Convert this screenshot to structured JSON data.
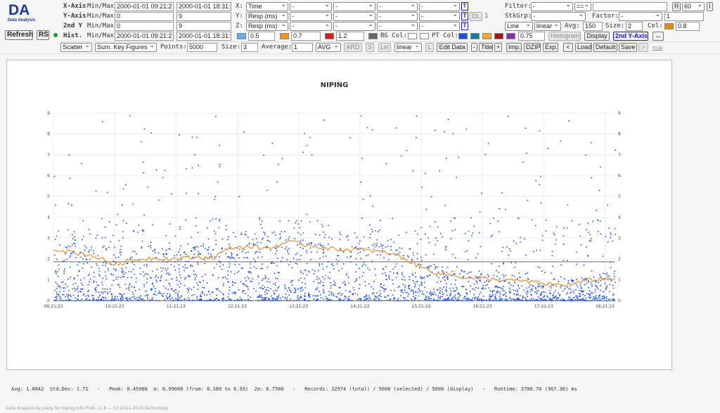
{
  "app": {
    "logo": "DA",
    "logo_sub": "Data Analysis",
    "refresh": "Refresh",
    "rs": "RS",
    "status_color": "#1aa01a"
  },
  "rows": {
    "xaxis": {
      "label": "X-Axis",
      "minmax": "Min/Max",
      "min": "2000-01-01 09:21:2",
      "max": "2000-01-01 18:31:4"
    },
    "yaxis": {
      "label": "Y-Axis",
      "minmax": "Min/Max",
      "min": "0",
      "max": "9"
    },
    "y2": {
      "label": "2nd Y",
      "minmax": "Min/Max",
      "min": "0",
      "max": "9"
    },
    "hist": {
      "label": "Hist.",
      "minmax": "Min/Max",
      "min": "2000-01-01 09:21:2",
      "max": "2000-01-01 18:31:4"
    }
  },
  "fields": {
    "x": {
      "label": "X:",
      "value": "Time"
    },
    "y": {
      "label": "Y:",
      "value": "Resp (ms)"
    },
    "z": {
      "label": "Z:",
      "value": "Resp (ms)"
    },
    "dash": "-",
    "t": "T",
    "dl": "DL",
    "dl_val": "1"
  },
  "right": {
    "filter_label": "Filter:",
    "filter_val": "-",
    "filter_op": "==",
    "r": "R",
    "r_val": "60",
    "i": "I",
    "stkgrp_label": "StkGrp:",
    "stkgrp_val": "-",
    "factor_label": "Factor:",
    "factor_val": "-",
    "factor_num": "1",
    "line": "Line",
    "linear": "linear",
    "avg_label": "Avg:",
    "avg_val": "150",
    "size_label": "Size:",
    "size_val": "2",
    "col_label": "Col:",
    "col_color": "#e08c1a",
    "col_val": "0.8"
  },
  "hist_row": {
    "c1": "#6fa8e8",
    "v1": "0.5",
    "c2": "#f0961e",
    "v2": "0.7",
    "c3": "#e01a1a",
    "v3": "1.2",
    "c4": "#666666",
    "bg_label": "BG Col:",
    "pt_label": "PT Col:",
    "pt1": "#1a4ee8",
    "pt2": "#1a7a9a",
    "pt3": "#f0a830",
    "pt4": "#a01a1a",
    "pt5": "#8a2ab0",
    "pt_val": "0.75",
    "histogram": "Histogram",
    "display": "Display",
    "y2axis": "2nd Y-Axis",
    "arrows": "↔"
  },
  "toolbar": {
    "type": "Scatter",
    "agg": "Sum. Key Figures",
    "points_label": "Points:",
    "points": "5000",
    "size_label": "Size:",
    "size": "3",
    "average_label": "Average:",
    "average": "1",
    "avgsel": "AVG",
    "ard": "ARD",
    "s": "S",
    "lin": "Lin",
    "linear": "linear",
    "l": "L",
    "edit": "Edit Data",
    "minus": "-",
    "title": "Title",
    "plus": "+",
    "imp": "Imp.",
    "dzip": "DZIP",
    "exp": "Exp.",
    "lt": "<",
    "load": "Load",
    "default": "Default",
    "save": "Save",
    "gt": ">",
    "hide": "Hide"
  },
  "chart_data": {
    "type": "scatter",
    "title": "NIPING",
    "xlabel": "",
    "ylabel": "",
    "x_ticks": [
      "09:21:23",
      "10:21:23",
      "11:21:23",
      "12:21:23",
      "13:21:23",
      "14:21:23",
      "15:21:23",
      "16:21:23",
      "17:21:23",
      "18:21:23"
    ],
    "ylim": [
      0,
      9
    ],
    "y_ticks": [
      "0",
      "1",
      "2",
      "3",
      "4",
      "5",
      "6",
      "7",
      "8",
      "9"
    ],
    "y2_ticks": [
      "0",
      "1",
      "2",
      "3",
      "4",
      "5",
      "6",
      "7",
      "8",
      "9"
    ],
    "reference_line": 1.86,
    "grid": true,
    "series": [
      {
        "type": "scatter",
        "color": "#1a4ee8",
        "points_note": "5000 points"
      },
      {
        "type": "line",
        "color": "#e8902a",
        "x_hours": [
          0,
          0.1,
          0.3,
          0.6,
          1.0,
          1.3,
          1.6,
          2.0,
          2.4,
          2.6,
          2.9,
          3.2,
          3.5,
          3.8,
          4.0,
          4.3,
          4.6,
          5.0,
          5.3,
          5.6,
          6.0,
          6.3,
          6.8,
          7.2,
          7.6,
          8.0,
          8.4,
          8.8,
          9.17
        ],
        "values": [
          2.5,
          2.45,
          2.3,
          2.2,
          1.75,
          1.95,
          2.05,
          2.0,
          2.1,
          2.05,
          2.55,
          2.6,
          2.5,
          2.8,
          2.75,
          2.6,
          2.45,
          2.45,
          2.35,
          2.2,
          1.6,
          1.3,
          1.1,
          1.0,
          0.95,
          0.8,
          0.75,
          1.0,
          1.1
        ]
      }
    ]
  },
  "footer": {
    "stats": "Avg: 1.8642  Std.Dev: 1.71   -   Peak: 0.45000  σ: 0.99000 (from: 0.180 to 6.93)  2σ: 6.7500   -   Records: 32974 (total) / 5000 (selected) / 5000 (display)   -   Runtime: 2700.70 (367.30) ms",
    "credit": "Data Analysis by Joerg for niping.info Prod. v1.8 — (c) 2011-2019 Technology"
  }
}
